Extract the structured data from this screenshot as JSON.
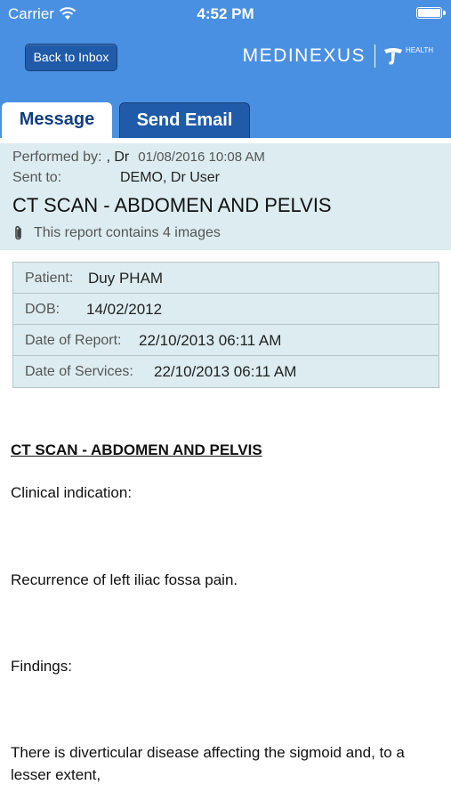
{
  "status_bar": {
    "carrier": "Carrier",
    "time": "4:52 PM",
    "battery_level": 1.0
  },
  "nav": {
    "back_label": "Back to Inbox",
    "logo_text": "MEDINEXUS",
    "logo_sub": "HEALTH"
  },
  "tabs": [
    {
      "label": "Message",
      "selected": true
    },
    {
      "label": "Send Email",
      "selected": false
    }
  ],
  "header": {
    "performed_label": "Performed by:",
    "performed_value": ", Dr",
    "performed_date": "01/08/2016 10:08 AM",
    "sent_label": "Sent to:",
    "sent_value": "DEMO, Dr User",
    "title": "CT SCAN - ABDOMEN AND PELVIS",
    "images_text": "This report contains 4 images"
  },
  "patient_table": [
    {
      "label": "Patient:",
      "value": "Duy PHAM"
    },
    {
      "label": "DOB:",
      "value": "14/02/2012"
    },
    {
      "label": "Date of Report:",
      "value": "22/10/2013 06:11 AM"
    },
    {
      "label": "Date of Services:",
      "value": "22/10/2013 06:11 AM"
    }
  ],
  "report": {
    "title": "CT SCAN - ABDOMEN AND PELVIS",
    "clinical_label": "Clinical indication:",
    "clinical_text": "Recurrence of left iliac fossa pain.",
    "findings_label": "Findings:",
    "findings_text": "There is diverticular disease affecting the sigmoid and, to a lesser extent,"
  },
  "colors": {
    "topbar": "#4a90e2",
    "button": "#1f5ba8",
    "tab_text": "#123d80",
    "header_bg": "#dcecf0"
  }
}
